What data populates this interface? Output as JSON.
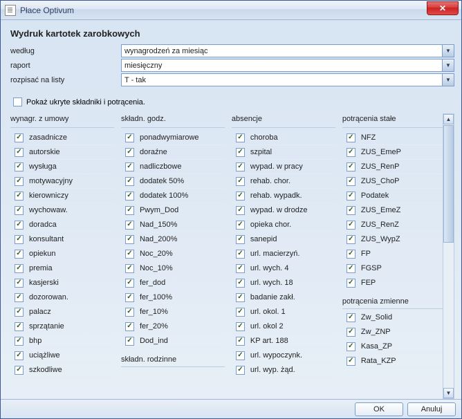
{
  "window": {
    "title": "Płace Optivum"
  },
  "heading": "Wydruk kartotek zarobkowych",
  "form": {
    "wedlug_label": "według",
    "wedlug_value": "wynagrodzeń za miesiąc",
    "raport_label": "raport",
    "raport_value": "miesięczny",
    "rozpisac_label": "rozpisać na listy",
    "rozpisac_value": "T - tak"
  },
  "show_hidden": {
    "checked": false,
    "label": "Pokaż ukryte składniki i potrącenia."
  },
  "columns": {
    "wynagr": {
      "header": "wynagr. z umowy",
      "items": [
        "zasadnicze",
        "autorskie",
        "wysługa",
        "motywacyjny",
        "kierowniczy",
        "wychowaw.",
        "doradca",
        "konsultant",
        "opiekun",
        "premia",
        "kasjerski",
        "dozorowan.",
        "palacz",
        "sprzątanie",
        "bhp",
        "uciążliwe",
        "szkodliwe"
      ]
    },
    "skladn_godz": {
      "header": "składn. godz.",
      "items": [
        "ponadwymiarowe",
        "doraźne",
        "nadliczbowe",
        "dodatek 50%",
        "dodatek 100%",
        "Pwym_Dod",
        "Nad_150%",
        "Nad_200%",
        "Noc_20%",
        "Noc_10%",
        "fer_dod",
        "fer_100%",
        "fer_10%",
        "fer_20%",
        "Dod_ind"
      ]
    },
    "skladn_rodz": {
      "header": "składn. rodzinne"
    },
    "absencje": {
      "header": "absencje",
      "items": [
        "choroba",
        "szpital",
        "wypad. w pracy",
        "rehab. chor.",
        "rehab. wypadk.",
        "wypad. w drodze",
        "opieka chor.",
        "sanepid",
        "url. macierzyń.",
        "url. wych. 4",
        "url. wych. 18",
        "badanie zakł.",
        "url. okol. 1",
        "url. okol 2",
        "KP art. 188",
        "url. wypoczynk.",
        "url. wyp. żąd."
      ]
    },
    "potr_stale": {
      "header": "potrącenia stałe",
      "items": [
        "NFZ",
        "ZUS_EmeP",
        "ZUS_RenP",
        "ZUS_ChoP",
        "Podatek",
        "ZUS_EmeZ",
        "ZUS_RenZ",
        "ZUS_WypZ",
        "FP",
        "FGSP",
        "FEP"
      ]
    },
    "potr_zm": {
      "header": "potrącenia zmienne",
      "items": [
        "Zw_Solid",
        "Zw_ZNP",
        "Kasa_ZP",
        "Rata_KZP"
      ]
    }
  },
  "buttons": {
    "ok": "OK",
    "cancel": "Anuluj"
  }
}
